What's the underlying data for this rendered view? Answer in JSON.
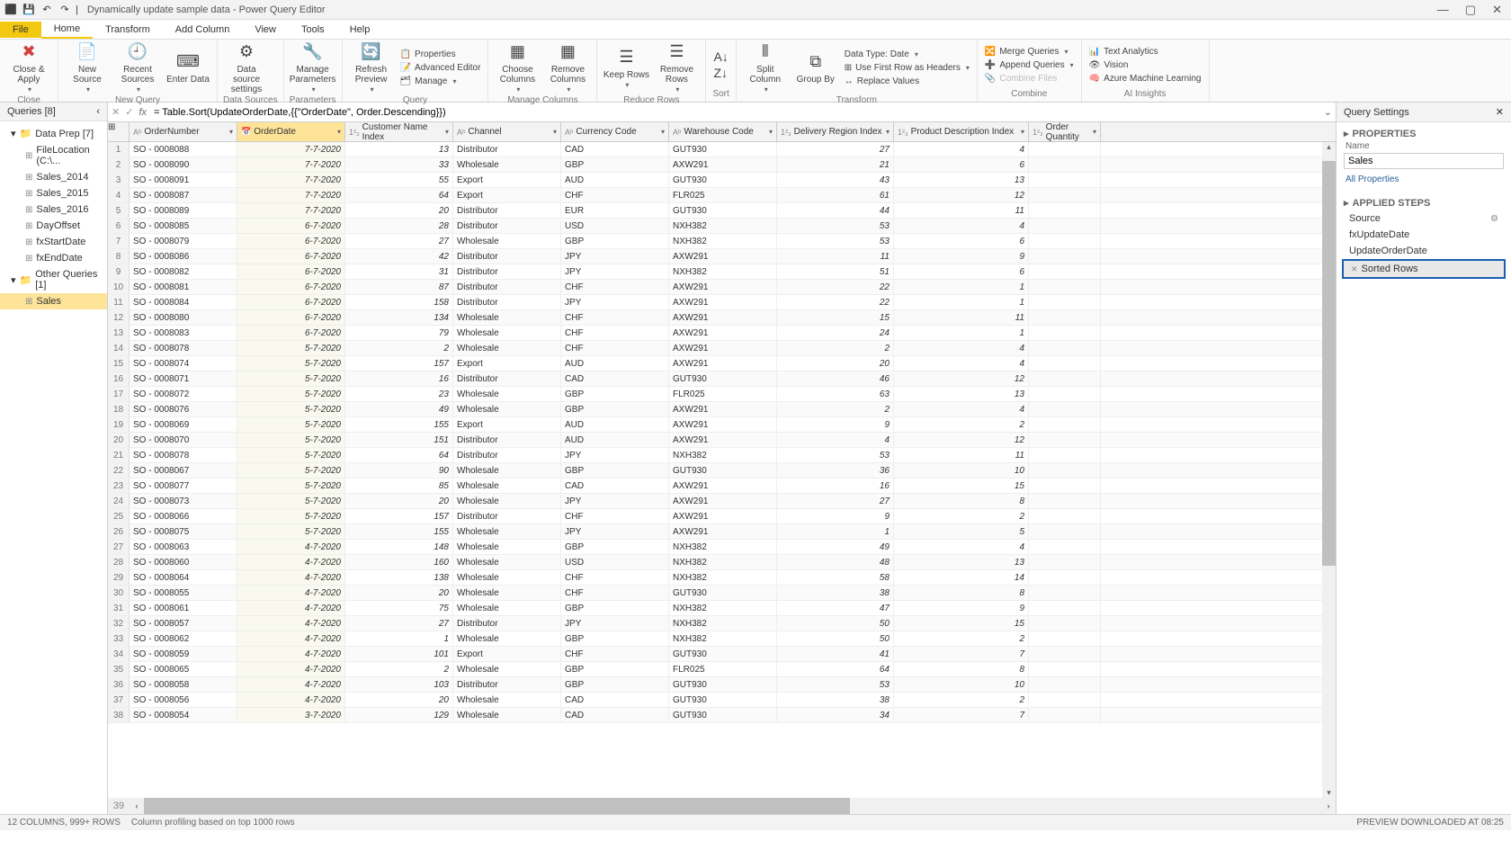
{
  "title": "Dynamically update sample data - Power Query Editor",
  "menutabs": {
    "file": "File",
    "home": "Home",
    "transform": "Transform",
    "addcol": "Add Column",
    "view": "View",
    "tools": "Tools",
    "help": "Help"
  },
  "ribbon": {
    "close_apply": "Close &\nApply",
    "close_grp": "Close",
    "new_source": "New\nSource",
    "recent_sources": "Recent\nSources",
    "enter_data": "Enter\nData",
    "nq_grp": "New Query",
    "ds_settings": "Data source\nsettings",
    "ds_grp": "Data Sources",
    "manage_params": "Manage\nParameters",
    "params_grp": "Parameters",
    "refresh": "Refresh\nPreview",
    "props": "Properties",
    "adv": "Advanced Editor",
    "manage": "Manage",
    "query_grp": "Query",
    "choose_cols": "Choose\nColumns",
    "remove_cols": "Remove\nColumns",
    "mc_grp": "Manage Columns",
    "keep_rows": "Keep\nRows",
    "remove_rows": "Remove\nRows",
    "rr_grp": "Reduce Rows",
    "sort_grp": "Sort",
    "split_col": "Split\nColumn",
    "group_by": "Group\nBy",
    "datatype": "Data Type: Date",
    "first_row": "Use First Row as Headers",
    "replace": "Replace Values",
    "tf_grp": "Transform",
    "merge": "Merge Queries",
    "append": "Append Queries",
    "combine_files": "Combine Files",
    "combine_grp": "Combine",
    "text_an": "Text Analytics",
    "vision": "Vision",
    "aml": "Azure Machine Learning",
    "ai_grp": "AI Insights"
  },
  "formula": "= Table.Sort(UpdateOrderDate,{{\"OrderDate\", Order.Descending}})",
  "queries_hdr": "Queries [8]",
  "qtree": {
    "folder1": "Data Prep [7]",
    "items1": [
      "FileLocation (C:\\...",
      "Sales_2014",
      "Sales_2015",
      "Sales_2016",
      "DayOffset",
      "fxStartDate",
      "fxEndDate"
    ],
    "folder2": "Other Queries [1]",
    "items2": [
      "Sales"
    ]
  },
  "columns": [
    "OrderNumber",
    "OrderDate",
    "Customer Name Index",
    "Channel",
    "Currency Code",
    "Warehouse Code",
    "Delivery Region Index",
    "Product Description Index",
    "Order Quantity"
  ],
  "rows": [
    [
      "SO - 0008088",
      "7-7-2020",
      "13",
      "Distributor",
      "CAD",
      "GUT930",
      "27",
      "4",
      ""
    ],
    [
      "SO - 0008090",
      "7-7-2020",
      "33",
      "Wholesale",
      "GBP",
      "AXW291",
      "21",
      "6",
      ""
    ],
    [
      "SO - 0008091",
      "7-7-2020",
      "55",
      "Export",
      "AUD",
      "GUT930",
      "43",
      "13",
      ""
    ],
    [
      "SO - 0008087",
      "7-7-2020",
      "64",
      "Export",
      "CHF",
      "FLR025",
      "61",
      "12",
      ""
    ],
    [
      "SO - 0008089",
      "7-7-2020",
      "20",
      "Distributor",
      "EUR",
      "GUT930",
      "44",
      "11",
      ""
    ],
    [
      "SO - 0008085",
      "6-7-2020",
      "28",
      "Distributor",
      "USD",
      "NXH382",
      "53",
      "4",
      ""
    ],
    [
      "SO - 0008079",
      "6-7-2020",
      "27",
      "Wholesale",
      "GBP",
      "NXH382",
      "53",
      "6",
      ""
    ],
    [
      "SO - 0008086",
      "6-7-2020",
      "42",
      "Distributor",
      "JPY",
      "AXW291",
      "11",
      "9",
      ""
    ],
    [
      "SO - 0008082",
      "6-7-2020",
      "31",
      "Distributor",
      "JPY",
      "NXH382",
      "51",
      "6",
      ""
    ],
    [
      "SO - 0008081",
      "6-7-2020",
      "87",
      "Distributor",
      "CHF",
      "AXW291",
      "22",
      "1",
      ""
    ],
    [
      "SO - 0008084",
      "6-7-2020",
      "158",
      "Distributor",
      "JPY",
      "AXW291",
      "22",
      "1",
      ""
    ],
    [
      "SO - 0008080",
      "6-7-2020",
      "134",
      "Wholesale",
      "CHF",
      "AXW291",
      "15",
      "11",
      ""
    ],
    [
      "SO - 0008083",
      "6-7-2020",
      "79",
      "Wholesale",
      "CHF",
      "AXW291",
      "24",
      "1",
      ""
    ],
    [
      "SO - 0008078",
      "5-7-2020",
      "2",
      "Wholesale",
      "CHF",
      "AXW291",
      "2",
      "4",
      ""
    ],
    [
      "SO - 0008074",
      "5-7-2020",
      "157",
      "Export",
      "AUD",
      "AXW291",
      "20",
      "4",
      ""
    ],
    [
      "SO - 0008071",
      "5-7-2020",
      "16",
      "Distributor",
      "CAD",
      "GUT930",
      "46",
      "12",
      ""
    ],
    [
      "SO - 0008072",
      "5-7-2020",
      "23",
      "Wholesale",
      "GBP",
      "FLR025",
      "63",
      "13",
      ""
    ],
    [
      "SO - 0008076",
      "5-7-2020",
      "49",
      "Wholesale",
      "GBP",
      "AXW291",
      "2",
      "4",
      ""
    ],
    [
      "SO - 0008069",
      "5-7-2020",
      "155",
      "Export",
      "AUD",
      "AXW291",
      "9",
      "2",
      ""
    ],
    [
      "SO - 0008070",
      "5-7-2020",
      "151",
      "Distributor",
      "AUD",
      "AXW291",
      "4",
      "12",
      ""
    ],
    [
      "SO - 0008078",
      "5-7-2020",
      "64",
      "Distributor",
      "JPY",
      "NXH382",
      "53",
      "11",
      ""
    ],
    [
      "SO - 0008067",
      "5-7-2020",
      "90",
      "Wholesale",
      "GBP",
      "GUT930",
      "36",
      "10",
      ""
    ],
    [
      "SO - 0008077",
      "5-7-2020",
      "85",
      "Wholesale",
      "CAD",
      "AXW291",
      "16",
      "15",
      ""
    ],
    [
      "SO - 0008073",
      "5-7-2020",
      "20",
      "Wholesale",
      "JPY",
      "AXW291",
      "27",
      "8",
      ""
    ],
    [
      "SO - 0008066",
      "5-7-2020",
      "157",
      "Distributor",
      "CHF",
      "AXW291",
      "9",
      "2",
      ""
    ],
    [
      "SO - 0008075",
      "5-7-2020",
      "155",
      "Wholesale",
      "JPY",
      "AXW291",
      "1",
      "5",
      ""
    ],
    [
      "SO - 0008063",
      "4-7-2020",
      "148",
      "Wholesale",
      "GBP",
      "NXH382",
      "49",
      "4",
      ""
    ],
    [
      "SO - 0008060",
      "4-7-2020",
      "160",
      "Wholesale",
      "USD",
      "NXH382",
      "48",
      "13",
      ""
    ],
    [
      "SO - 0008064",
      "4-7-2020",
      "138",
      "Wholesale",
      "CHF",
      "NXH382",
      "58",
      "14",
      ""
    ],
    [
      "SO - 0008055",
      "4-7-2020",
      "20",
      "Wholesale",
      "CHF",
      "GUT930",
      "38",
      "8",
      ""
    ],
    [
      "SO - 0008061",
      "4-7-2020",
      "75",
      "Wholesale",
      "GBP",
      "NXH382",
      "47",
      "9",
      ""
    ],
    [
      "SO - 0008057",
      "4-7-2020",
      "27",
      "Distributor",
      "JPY",
      "NXH382",
      "50",
      "15",
      ""
    ],
    [
      "SO - 0008062",
      "4-7-2020",
      "1",
      "Wholesale",
      "GBP",
      "NXH382",
      "50",
      "2",
      ""
    ],
    [
      "SO - 0008059",
      "4-7-2020",
      "101",
      "Export",
      "CHF",
      "GUT930",
      "41",
      "7",
      ""
    ],
    [
      "SO - 0008065",
      "4-7-2020",
      "2",
      "Wholesale",
      "GBP",
      "FLR025",
      "64",
      "8",
      ""
    ],
    [
      "SO - 0008058",
      "4-7-2020",
      "103",
      "Distributor",
      "GBP",
      "GUT930",
      "53",
      "10",
      ""
    ],
    [
      "SO - 0008056",
      "4-7-2020",
      "20",
      "Wholesale",
      "CAD",
      "GUT930",
      "38",
      "2",
      ""
    ],
    [
      "SO - 0008054",
      "3-7-2020",
      "129",
      "Wholesale",
      "CAD",
      "GUT930",
      "34",
      "7",
      ""
    ]
  ],
  "settings": {
    "hdr": "Query Settings",
    "props": "PROPERTIES",
    "name_lbl": "Name",
    "name_val": "Sales",
    "all_props": "All Properties",
    "applied": "APPLIED STEPS",
    "steps": [
      "Source",
      "fxUpdateDate",
      "UpdateOrderDate",
      "Sorted Rows"
    ]
  },
  "status": {
    "cols": "12 COLUMNS, 999+ ROWS",
    "profile": "Column profiling based on top 1000 rows",
    "preview": "PREVIEW DOWNLOADED AT 08:25"
  }
}
